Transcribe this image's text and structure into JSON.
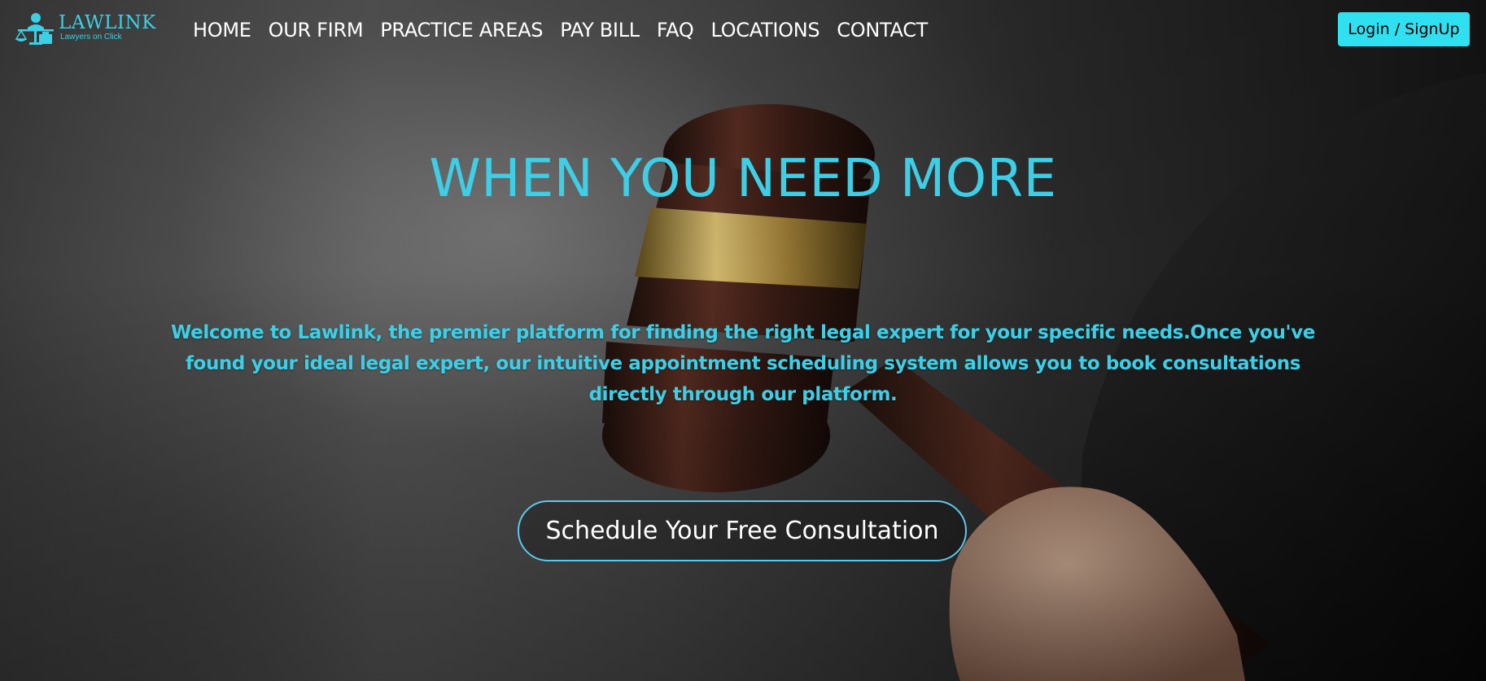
{
  "brand": {
    "name": "LAWLINK",
    "tagline": "Lawyers on Click",
    "logo_icon": "scales-lawyer-icon",
    "accent_color": "#3bd0e6"
  },
  "nav": {
    "items": [
      {
        "label": "HOME"
      },
      {
        "label": "OUR FIRM"
      },
      {
        "label": "PRACTICE AREAS"
      },
      {
        "label": "PAY BILL"
      },
      {
        "label": "FAQ"
      },
      {
        "label": "LOCATIONS"
      },
      {
        "label": "CONTACT"
      }
    ],
    "login_label": "Login / SignUp",
    "login_color": "#2fe0f0"
  },
  "hero": {
    "background": "judge-gavel-photo",
    "title": "WHEN YOU NEED MORE",
    "description": "Welcome to Lawlink, the premier platform for finding the right legal expert for your specific needs.Once you've found your ideal legal expert, our intuitive appointment scheduling system allows you to book consultations directly through our platform.",
    "cta_label": "Schedule Your Free Consultation",
    "text_color": "#3ccfe7"
  }
}
